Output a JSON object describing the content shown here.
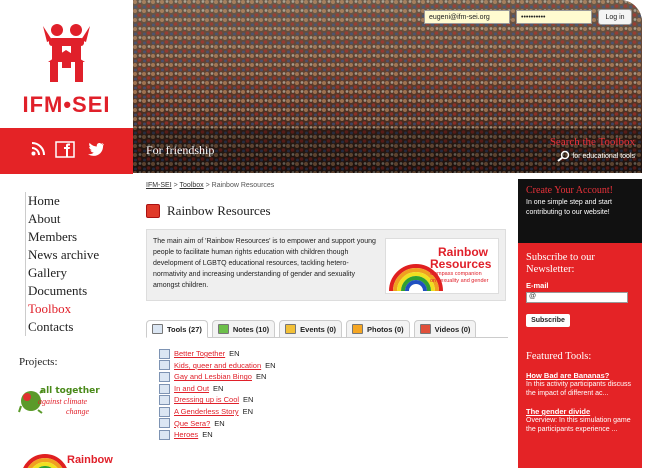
{
  "brand": {
    "logo_text": "IFM•SEI"
  },
  "colors": {
    "brand_red": "#e42326",
    "dark": "#111111",
    "link_red": "#e0202a"
  },
  "social": [
    "rss-icon",
    "facebook-icon",
    "twitter-icon"
  ],
  "nav": {
    "items": [
      "Home",
      "About",
      "Members",
      "News archive",
      "Gallery",
      "Documents",
      "Toolbox",
      "Contacts"
    ],
    "active": "Toolbox"
  },
  "projects": {
    "label": "Projects:",
    "all_together": {
      "line1": "all together",
      "line2": "against climate",
      "line3": "change"
    },
    "rainbow_label": "Rainbow"
  },
  "header": {
    "tagline": "For friendship",
    "login": {
      "email": "eugeni@ifm-sei.org",
      "password": "••••••••••",
      "button": "Log in"
    },
    "search": {
      "title": "Search the Toolbox",
      "subtitle": "for educational tools"
    }
  },
  "breadcrumb": {
    "root": "IFM-SEI",
    "sep1": " > ",
    "section": "Toolbox",
    "sep2": " > ",
    "current": "Rainbow Resources"
  },
  "page": {
    "title": "Rainbow Resources",
    "description": "The main aim of 'Rainbow Resources' is to empower and support young people to facilitate human rights education with children though development of LGBTQ educational resources, tackling hetero-normativity and increasing understanding of gender and sexuality amongst children.",
    "logo": {
      "line1": "Rainbow",
      "line2": "Resources",
      "tagline1": "Compass companion",
      "tagline2": "on sexuality and gender"
    }
  },
  "tabs": [
    "Tools (27)",
    "Notes (10)",
    "Events (0)",
    "Photos (0)",
    "Videos (0)"
  ],
  "tools": [
    {
      "name": "Better Together",
      "lang": "EN"
    },
    {
      "name": "Kids, queer and education",
      "lang": "EN"
    },
    {
      "name": "Gay and Lesbian Bingo",
      "lang": "EN"
    },
    {
      "name": "In and Out",
      "lang": "EN"
    },
    {
      "name": "Dressing up is Cool",
      "lang": "EN"
    },
    {
      "name": "A Genderless Story",
      "lang": "EN"
    },
    {
      "name": "Que Sera?",
      "lang": "EN"
    },
    {
      "name": "Heroes",
      "lang": "EN"
    }
  ],
  "sidebar": {
    "account": {
      "title": "Create Your Account!",
      "text": "In one simple step and start contributing to our website!"
    },
    "newsletter": {
      "title": "Subscribe to our Newsletter:",
      "email_label": "E-mail",
      "email_value": "@",
      "button": "Subscribe"
    },
    "featured": {
      "title": "Featured Tools:",
      "items": [
        {
          "title": "How Bad are Bananas?",
          "text": "In this activity participants discuss the impact of different ac..."
        },
        {
          "title": "The gender divide",
          "text": "Overview: In this simulation game the participants experience ..."
        }
      ]
    }
  }
}
